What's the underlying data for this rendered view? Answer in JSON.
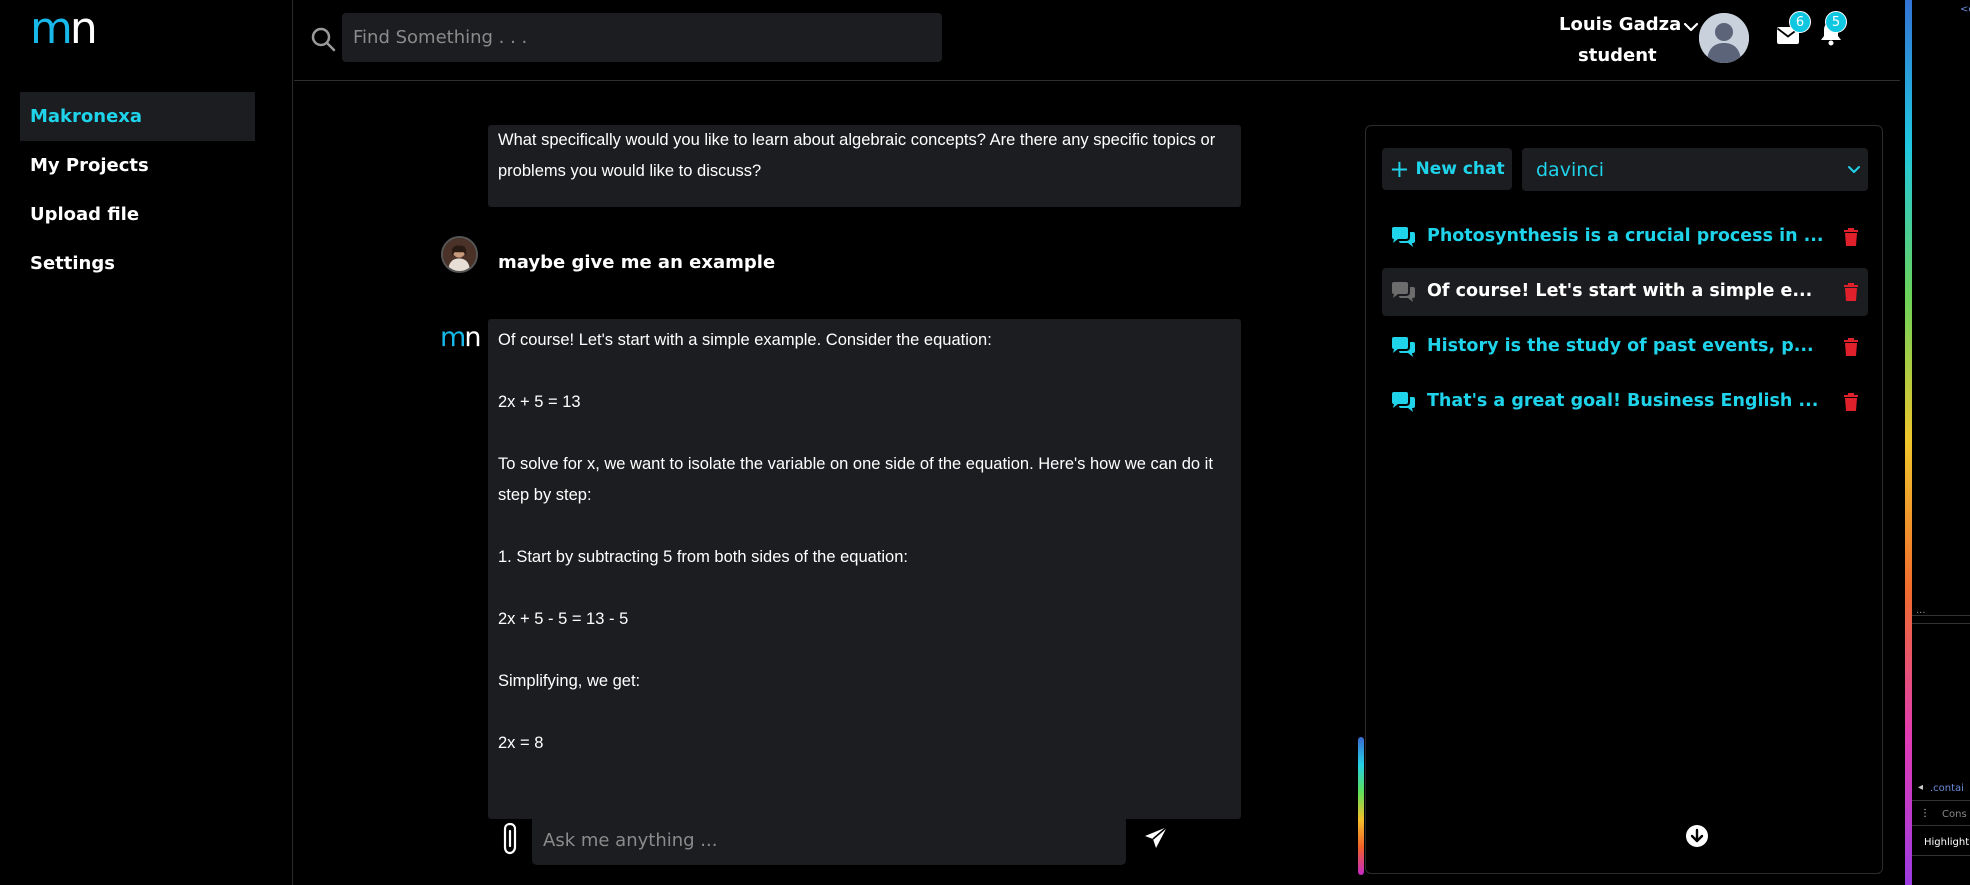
{
  "brand": {
    "logo_m": "m",
    "logo_n": "n"
  },
  "sidebar": {
    "items": [
      {
        "label": "Makronexa",
        "active": true
      },
      {
        "label": "My Projects",
        "active": false
      },
      {
        "label": "Upload file",
        "active": false
      },
      {
        "label": "Settings",
        "active": false
      }
    ]
  },
  "header": {
    "search_placeholder": "Find Something . . .",
    "user_name": "Louis Gadza",
    "user_role": "student",
    "mail_count": "6",
    "notification_count": "5"
  },
  "chat": {
    "messages": [
      {
        "role": "assistant",
        "text": "What specifically would you like to learn about algebraic concepts? Are there any specific topics or problems you would like to discuss?"
      },
      {
        "role": "user",
        "text": "maybe give me an example"
      },
      {
        "role": "assistant",
        "lines": [
          "Of course! Let's start with a simple example. Consider the equation:",
          "",
          "2x + 5 = 13",
          "",
          "To solve for x, we want to isolate the variable on one side of the equation. Here's how we can do it step by step:",
          "",
          "1. Start by subtracting 5 from both sides of the equation:",
          "",
          "2x + 5 - 5 = 13 - 5",
          "",
          "Simplifying, we get:",
          "",
          "2x = 8"
        ]
      }
    ],
    "composer_placeholder": "Ask me anything ..."
  },
  "history": {
    "new_chat_label": "New chat",
    "model": "davinci",
    "items": [
      {
        "title": "Photosynthesis is a crucial process in ...",
        "active": false
      },
      {
        "title": "Of course! Let's start with a simple e...",
        "active": true
      },
      {
        "title": "History is the study of past events, p...",
        "active": false
      },
      {
        "title": "That's a great goal! Business English ...",
        "active": false
      }
    ]
  },
  "devtools": {
    "breadcrumb": ".contai",
    "console_tab": "Cons",
    "highlight_label": "Highlight",
    "top_text": "<c"
  },
  "colors": {
    "accent": "#1fd3ea",
    "brand_blue": "#17b8ea",
    "panel_bg": "#1c1d20",
    "danger": "#e0212b"
  }
}
